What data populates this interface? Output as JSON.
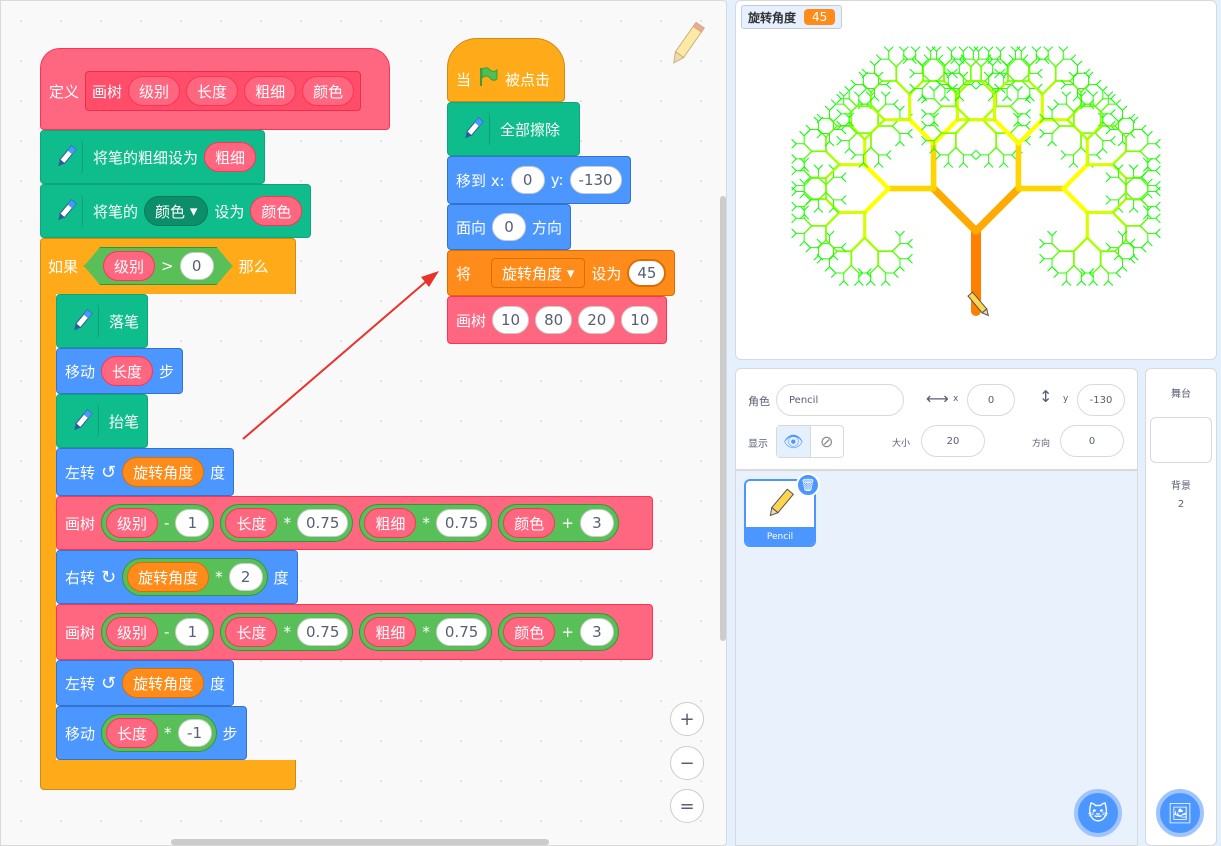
{
  "define": {
    "label": "定义",
    "name": "画树",
    "params": [
      "级别",
      "长度",
      "粗细",
      "颜色"
    ]
  },
  "pen_size": {
    "label": "将笔的粗细设为",
    "value": "粗细"
  },
  "pen_color": {
    "label": "将笔的",
    "menu": "颜色",
    "mid": "设为",
    "value": "颜色"
  },
  "if": {
    "label": "如果",
    "left": "级别",
    "op": ">",
    "right": "0",
    "then": "那么"
  },
  "pen_down": "落笔",
  "move1": {
    "label": "移动",
    "value": "长度",
    "unit": "步"
  },
  "pen_up": "抬笔",
  "turn_left1": {
    "label": "左转",
    "value": "旋转角度",
    "unit": "度"
  },
  "draw1": {
    "label": "画树",
    "a": [
      "级别",
      "-",
      "1"
    ],
    "b": [
      "长度",
      "*",
      "0.75"
    ],
    "c": [
      "粗细",
      "*",
      "0.75"
    ],
    "d": [
      "颜色",
      "+",
      "3"
    ]
  },
  "turn_right": {
    "label": "右转",
    "value": "旋转角度",
    "op": "*",
    "num": "2",
    "unit": "度"
  },
  "draw2": {
    "label": "画树",
    "a": [
      "级别",
      "-",
      "1"
    ],
    "b": [
      "长度",
      "*",
      "0.75"
    ],
    "c": [
      "粗细",
      "*",
      "0.75"
    ],
    "d": [
      "颜色",
      "+",
      "3"
    ]
  },
  "turn_left2": {
    "label": "左转",
    "value": "旋转角度",
    "unit": "度"
  },
  "move2": {
    "label": "移动",
    "value": "长度",
    "op": "*",
    "num": "-1",
    "unit": "步"
  },
  "hat": {
    "when": "当",
    "clicked": "被点击"
  },
  "clear": "全部擦除",
  "goto": {
    "label": "移到 x:",
    "x": "0",
    "ylabel": "y:",
    "y": "-130"
  },
  "point": {
    "label": "面向",
    "value": "0",
    "unit": "方向"
  },
  "setvar": {
    "label": "将",
    "var": "旋转角度",
    "mid": "设为",
    "value": "45"
  },
  "call": {
    "label": "画树",
    "args": [
      "10",
      "80",
      "20",
      "10"
    ]
  },
  "zoom": {
    "in": "+",
    "out": "−",
    "reset": "="
  },
  "monitor": {
    "name": "旋转角度",
    "value": "45"
  },
  "sprite_info": {
    "sprite_label": "角色",
    "sprite_name": "Pencil",
    "x_label": "x",
    "x": "0",
    "y_label": "y",
    "y": "-130",
    "show_label": "显示",
    "size_label": "大小",
    "size": "20",
    "dir_label": "方向",
    "dir": "0"
  },
  "sprite_tile": {
    "name": "Pencil"
  },
  "stage_panel": {
    "title": "舞台",
    "backdrops_label": "背景",
    "backdrops": "2"
  },
  "colors": {
    "pink": "#ff6680",
    "teal": "#0fbd8c",
    "blue": "#4c97ff",
    "orange": "#ffab19",
    "var_orange": "#ff8c1a",
    "green": "#59c059",
    "flag": "#4cbf56",
    "arrow": "#e8322a"
  }
}
